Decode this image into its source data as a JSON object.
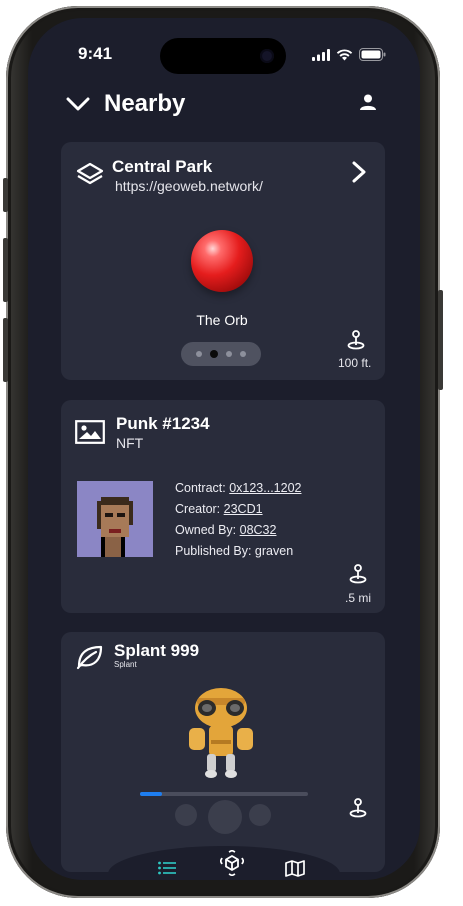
{
  "status_bar": {
    "time": "9:41"
  },
  "header": {
    "title": "Nearby"
  },
  "cards": [
    {
      "title": "Central Park",
      "subtitle": "https://geoweb.network/",
      "content_label": "The Orb",
      "pager": {
        "count": 4,
        "active_index": 1
      },
      "distance": "100 ft."
    },
    {
      "title": "Punk #1234",
      "subtitle": "NFT",
      "details": {
        "contract_label": "Contract:",
        "contract_value": "0x123...1202",
        "creator_label": "Creator:",
        "creator_value": "23CD1",
        "owned_label": "Owned By:",
        "owned_value": "08C32",
        "published_label": "Published By:",
        "published_value": "graven"
      },
      "distance": ".5 mi"
    },
    {
      "title": "Splant 999",
      "subtitle": "Splant",
      "progress": 0.13
    }
  ],
  "icons": {
    "back": "chevron-down-icon",
    "profile": "person-icon",
    "layers": "layers-icon",
    "image": "image-icon",
    "leaf": "leaf-icon",
    "distance": "location-pin-icon",
    "tab_list": "list-icon",
    "tab_ar": "ar-cube-icon",
    "tab_map": "map-icon"
  },
  "colors": {
    "background": "#1c1e2c",
    "card": "#292c3b",
    "accent": "#1e7ef0",
    "list_tab_active": "#2ec9c4"
  }
}
